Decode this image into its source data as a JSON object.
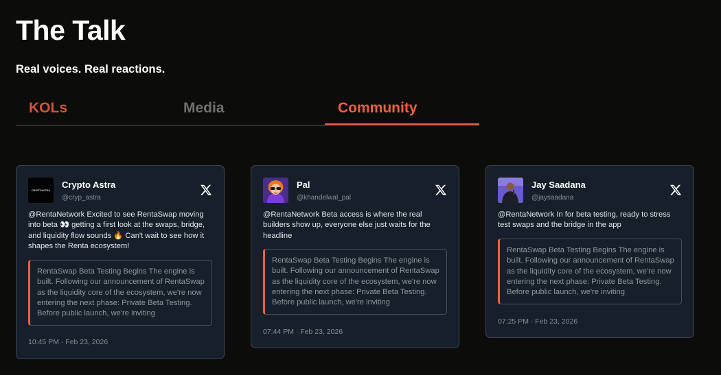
{
  "page": {
    "title": "The Talk",
    "subtitle": "Real voices. Real reactions."
  },
  "tabs": [
    {
      "label": "KOLs"
    },
    {
      "label": "Media"
    },
    {
      "label": "Community",
      "active": true
    }
  ],
  "colors": {
    "background": "#0c0c0a",
    "accent": "#f0613f",
    "card_bg": "#17202a",
    "inactive_tab": "#6f6f6b"
  },
  "cards": [
    {
      "name": "Crypto Astra",
      "handle": "@cryp_astra",
      "avatar_label": "CRYPTOASTRA",
      "text": "@RentaNetwork Excited to see RentaSwap moving into beta 👀 getting a first look at the swaps, bridge, and liquidity flow sounds 🔥 Can't wait to see how it shapes the Renta ecosystem!",
      "quote": "RentaSwap Beta Testing Begins The engine is built. Following our announcement of RentaSwap as the liquidity core of the ecosystem, we're now entering the next phase: Private Beta Testing. Before public launch, we're inviting",
      "time": "10:45 PM · Feb 23, 2026"
    },
    {
      "name": "Pal",
      "handle": "@khandelwal_pal",
      "text": "@RentaNetwork Beta access is where the real builders show up, everyone else just waits for the headline",
      "quote": "RentaSwap Beta Testing Begins The engine is built. Following our announcement of RentaSwap as the liquidity core of the ecosystem, we're now entering the next phase: Private Beta Testing. Before public launch, we're inviting",
      "time": "07:44 PM · Feb 23, 2026"
    },
    {
      "name": "Jay Saadana",
      "handle": "@jaysaadana",
      "text": "@RentaNetwork In for beta testing, ready to stress test swaps and the bridge in the app",
      "quote": "RentaSwap Beta Testing Begins The engine is built. Following our announcement of RentaSwap as the liquidity core of the ecosystem, we're now entering the next phase: Private Beta Testing. Before public launch, we're inviting",
      "time": "07:25 PM · Feb 23, 2026"
    }
  ]
}
